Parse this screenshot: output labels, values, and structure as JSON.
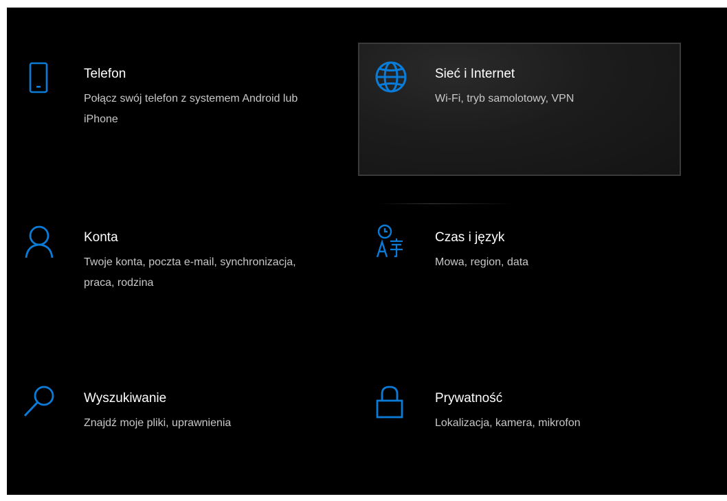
{
  "accent": "#0a7cd8",
  "tiles": [
    {
      "icon": "phone-icon",
      "title": "Telefon",
      "desc": "Połącz swój telefon z systemem Android lub iPhone"
    },
    {
      "icon": "globe-icon",
      "title": "Sieć i Internet",
      "desc": "Wi-Fi, tryb samolotowy, VPN"
    },
    {
      "icon": "person-icon",
      "title": "Konta",
      "desc": "Twoje konta, poczta e-mail, synchronizacja, praca, rodzina"
    },
    {
      "icon": "time-language-icon",
      "title": "Czas i język",
      "desc": "Mowa, region, data"
    },
    {
      "icon": "search-icon",
      "title": "Wyszukiwanie",
      "desc": "Znajdź moje pliki, uprawnienia"
    },
    {
      "icon": "lock-icon",
      "title": "Prywatność",
      "desc": "Lokalizacja, kamera, mikrofon"
    }
  ]
}
